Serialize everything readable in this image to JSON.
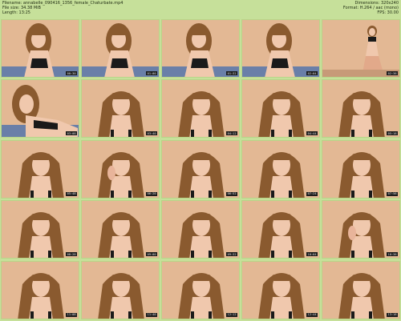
{
  "header": {
    "filename_label": "Filename:",
    "filename_value": "annabelle_090416_1356_female_Chaturbate.mp4",
    "filesize_label": "File size:",
    "filesize_value": "34.38 MiB",
    "length_label": "Length:",
    "length_value": "13:25",
    "dimensions_label": "Dimensions:",
    "dimensions_value": "320x240",
    "format_label": "Format:",
    "format_value": "H.264 / aac (mono)",
    "fps_label": "FPS:",
    "fps_value": "30.00"
  },
  "thumbnails": [
    {
      "time": "00:30",
      "pose": "lean"
    },
    {
      "time": "01:00",
      "pose": "lean"
    },
    {
      "time": "01:32",
      "pose": "lean"
    },
    {
      "time": "02:04",
      "pose": "lean"
    },
    {
      "time": "02:36",
      "pose": "kneel"
    },
    {
      "time": "03:08",
      "pose": "lie"
    },
    {
      "time": "03:40",
      "pose": "portrait"
    },
    {
      "time": "04:12",
      "pose": "portrait"
    },
    {
      "time": "04:44",
      "pose": "portrait"
    },
    {
      "time": "05:16",
      "pose": "portrait"
    },
    {
      "time": "05:48",
      "pose": "portrait"
    },
    {
      "time": "06:20",
      "pose": "hand"
    },
    {
      "time": "06:52",
      "pose": "portrait"
    },
    {
      "time": "07:24",
      "pose": "portrait"
    },
    {
      "time": "07:56",
      "pose": "portrait"
    },
    {
      "time": "08:28",
      "pose": "portrait"
    },
    {
      "time": "09:00",
      "pose": "portrait"
    },
    {
      "time": "09:32",
      "pose": "portrait"
    },
    {
      "time": "10:04",
      "pose": "portrait"
    },
    {
      "time": "10:36",
      "pose": "hand"
    },
    {
      "time": "11:08",
      "pose": "portrait"
    },
    {
      "time": "11:40",
      "pose": "portrait"
    },
    {
      "time": "12:12",
      "pose": "portrait"
    },
    {
      "time": "12:44",
      "pose": "portrait"
    },
    {
      "time": "13:16",
      "pose": "portrait"
    }
  ],
  "colors": {
    "background": "#c6e09a",
    "wall": "#e3b894",
    "hair": "#8a5a2f",
    "skin": "#f0c8ad",
    "top": "#1a1a1a",
    "bed": "#6a7fa8"
  }
}
